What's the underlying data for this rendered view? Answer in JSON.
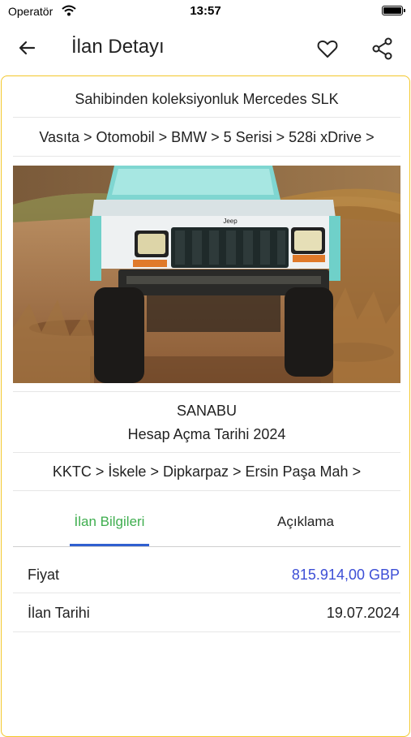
{
  "status_bar": {
    "carrier": "Operatör",
    "time": "13:57"
  },
  "nav": {
    "title": "İlan Detayı"
  },
  "listing": {
    "title": "Sahibinden koleksiyonluk Mercedes SLK",
    "category_path": "Vasıta > Otomobil > BMW > 5 Serisi > 528i xDrive  >",
    "seller": {
      "name": "SANABU",
      "account_date": "Hesap Açma Tarihi 2024"
    },
    "location_path": "KKTC > İskele > Dipkarpaz > Ersin Paşa Mah >",
    "photo_badge": "Jeep"
  },
  "tabs": [
    {
      "label": "İlan Bilgileri",
      "active": true
    },
    {
      "label": "Açıklama",
      "active": false
    }
  ],
  "details": [
    {
      "label": "Fiyat",
      "value": "815.914,00 GBP",
      "color": "#3d4fd6"
    },
    {
      "label": "İlan Tarihi",
      "value": "19.07.2024",
      "color": "#222222"
    }
  ],
  "colors": {
    "card_border": "#f3c72a",
    "tab_active_text": "#3fae4f",
    "tab_indicator": "#2f5fd0",
    "price": "#3d4fd6"
  }
}
